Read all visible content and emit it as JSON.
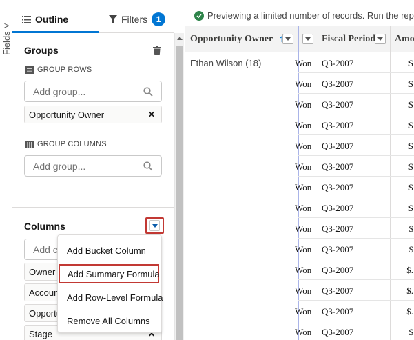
{
  "fields_strip": {
    "label": "Fields",
    "chevron": ">"
  },
  "tabs": {
    "outline_label": "Outline",
    "filters_label": "Filters",
    "filters_count": "1"
  },
  "groups": {
    "title": "Groups",
    "group_rows_label": "GROUP ROWS",
    "group_rows_placeholder": "Add group...",
    "group_rows_items": [
      "Opportunity Owner"
    ],
    "group_columns_label": "GROUP COLUMNS",
    "group_columns_placeholder": "Add group..."
  },
  "columns": {
    "title": "Columns",
    "search_placeholder": "Add co",
    "items": [
      "Owner R",
      "Accoun",
      "Opportu",
      "Stage"
    ]
  },
  "column_menu": {
    "items": [
      "Add Bucket Column",
      "Add Summary Formula",
      "Add Row-Level Formula",
      "Remove All Columns"
    ],
    "highlighted_index": 1
  },
  "grid": {
    "notice": "Previewing a limited number of records. Run the report to",
    "headers": {
      "owner": "Opportunity Owner",
      "sort_icon": "↑",
      "fiscal_period": "Fiscal Period",
      "amount": "Amou"
    },
    "group_label": "Ethan Wilson (18)",
    "rows": [
      {
        "stage": "Won",
        "period": "Q3-2007",
        "amount": "S"
      },
      {
        "stage": "Won",
        "period": "Q3-2007",
        "amount": "S"
      },
      {
        "stage": "Won",
        "period": "Q3-2007",
        "amount": "S"
      },
      {
        "stage": "Won",
        "period": "Q3-2007",
        "amount": "S"
      },
      {
        "stage": "Won",
        "period": "Q3-2007",
        "amount": "S"
      },
      {
        "stage": "Won",
        "period": "Q3-2007",
        "amount": "S"
      },
      {
        "stage": "Won",
        "period": "Q3-2007",
        "amount": "S"
      },
      {
        "stage": "Won",
        "period": "Q3-2007",
        "amount": "S"
      },
      {
        "stage": "Won",
        "period": "Q3-2007",
        "amount": "$"
      },
      {
        "stage": "Won",
        "period": "Q3-2007",
        "amount": "$"
      },
      {
        "stage": "Won",
        "period": "Q3-2007",
        "amount": "$."
      },
      {
        "stage": "Won",
        "period": "Q3-2007",
        "amount": "$."
      },
      {
        "stage": "Won",
        "period": "Q3-2007",
        "amount": "$."
      },
      {
        "stage": "Won",
        "period": "Q3-2007",
        "amount": "$"
      }
    ]
  },
  "colors": {
    "accent": "#0176d3",
    "highlight_border": "#c23934",
    "success": "#2e844a"
  }
}
